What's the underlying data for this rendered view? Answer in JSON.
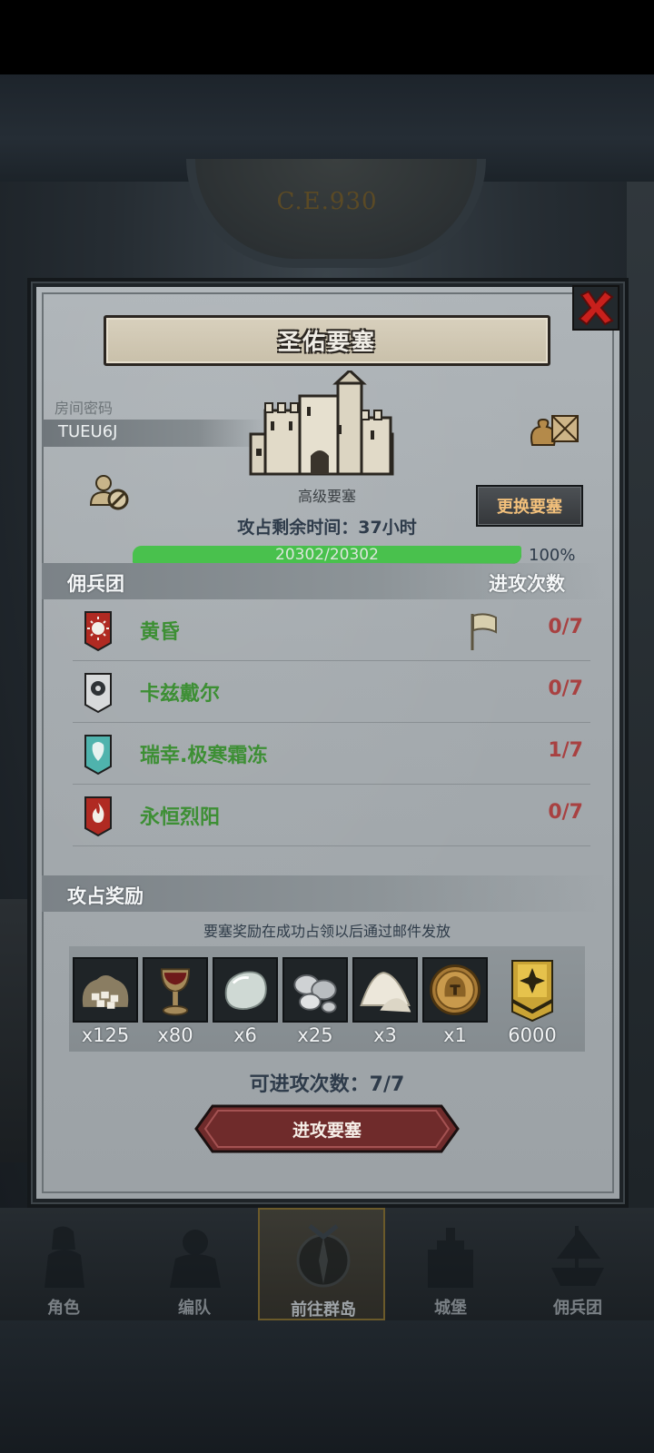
{
  "background": {
    "era_label": "C.E.930"
  },
  "dialog": {
    "title": "圣佑要塞",
    "room_label": "房间密码",
    "room_code": "TUEU6J",
    "fortress_type": "高级要塞",
    "change_button": "更换要塞",
    "time_left": "攻占剩余时间：37小时",
    "hp_text": "20302/20302",
    "hp_progress": 1.0,
    "hp_percent": "100%",
    "mercs_header": "佣兵团",
    "attacks_header": "进攻次数",
    "mercenaries": [
      {
        "name": "黄昏",
        "count": "0/7",
        "banner": "sun-banner-icon",
        "color": "#b02a22"
      },
      {
        "name": "卡兹戴尔",
        "count": "0/7",
        "banner": "eye-banner-icon",
        "color": "#3a3f44"
      },
      {
        "name": "瑞幸.极寒霜冻",
        "count": "1/7",
        "banner": "frost-banner-icon",
        "color": "#3c9a9a"
      },
      {
        "name": "永恒烈阳",
        "count": "0/7",
        "banner": "flame-banner-icon",
        "color": "#b02a22"
      }
    ],
    "rewards_header": "攻占奖励",
    "rewards_note": "要塞奖励在成功占领以后通过邮件发放",
    "rewards": [
      {
        "icon": "sugar-sack-icon",
        "qty": "x125"
      },
      {
        "icon": "goblet-icon",
        "qty": "x80"
      },
      {
        "icon": "pebble-icon",
        "qty": "x6"
      },
      {
        "icon": "silver-ore-icon",
        "qty": "x25"
      },
      {
        "icon": "salt-pile-icon",
        "qty": "x3"
      },
      {
        "icon": "helmet-coin-icon",
        "qty": "x1"
      },
      {
        "icon": "guild-emblem-icon",
        "qty": "6000"
      }
    ],
    "attack_count": "可进攻次数：7/7",
    "attack_button": "进攻要塞"
  },
  "tabs": [
    {
      "label": "角色",
      "icon": "knight-icon",
      "active": false
    },
    {
      "label": "编队",
      "icon": "squad-icon",
      "active": false
    },
    {
      "label": "前往群岛",
      "icon": "compass-icon",
      "active": true
    },
    {
      "label": "城堡",
      "icon": "castle-icon",
      "active": false
    },
    {
      "label": "佣兵团",
      "icon": "ship-icon",
      "active": false
    }
  ],
  "colors": {
    "merc_name": "#3d8f34",
    "count_red": "#a84141",
    "button_gold": "#f2c07b",
    "attack_button": "#6e2a2a"
  }
}
